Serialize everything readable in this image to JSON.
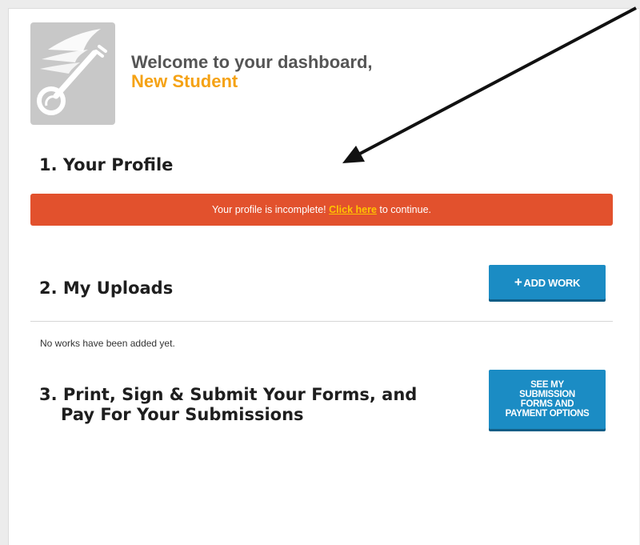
{
  "welcome": {
    "line1": "Welcome to your dashboard,",
    "name": "New Student"
  },
  "profile": {
    "title": "1. Your Profile",
    "alert_before": "Your profile is incomplete! ",
    "alert_link": "Click here",
    "alert_after": " to continue."
  },
  "uploads": {
    "title": "2. My Uploads",
    "add_button": "ADD WORK",
    "add_icon": "plus-icon",
    "empty_text": "No works have been added yet."
  },
  "submit": {
    "title_line1": "3. Print, Sign & Submit Your Forms, and",
    "title_line2": "Pay For Your Submissions",
    "button_lines": [
      "SEE MY",
      "SUBMISSION",
      "FORMS AND",
      "PAYMENT OPTIONS"
    ]
  },
  "colors": {
    "alert": "#e2512d",
    "accent": "#f5a214",
    "button": "#1b8cc4",
    "link": "#ffc400"
  },
  "annotation": {
    "icon": "arrow-icon"
  }
}
